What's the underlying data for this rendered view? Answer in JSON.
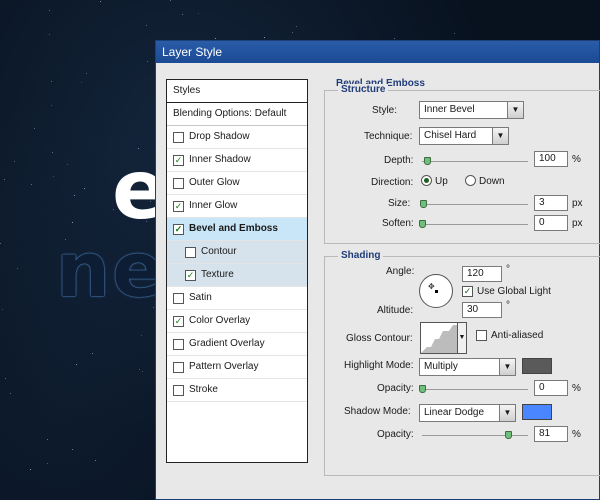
{
  "window": {
    "title": "Layer Style"
  },
  "styles_panel": {
    "header": "Styles",
    "blending_options": "Blending Options: Default",
    "items": [
      {
        "label": "Drop Shadow",
        "checked": false
      },
      {
        "label": "Inner Shadow",
        "checked": true
      },
      {
        "label": "Outer Glow",
        "checked": false
      },
      {
        "label": "Inner Glow",
        "checked": true
      },
      {
        "label": "Bevel and Emboss",
        "checked": true,
        "active": true
      },
      {
        "label": "Contour",
        "checked": false,
        "sub": true
      },
      {
        "label": "Texture",
        "checked": true,
        "sub": true
      },
      {
        "label": "Satin",
        "checked": false
      },
      {
        "label": "Color Overlay",
        "checked": true
      },
      {
        "label": "Gradient Overlay",
        "checked": false
      },
      {
        "label": "Pattern Overlay",
        "checked": false
      },
      {
        "label": "Stroke",
        "checked": false
      }
    ]
  },
  "bevel": {
    "section_title": "Bevel and Emboss",
    "structure": {
      "title": "Structure",
      "style_label": "Style:",
      "style_value": "Inner Bevel",
      "technique_label": "Technique:",
      "technique_value": "Chisel Hard",
      "depth_label": "Depth:",
      "depth_value": "100",
      "depth_unit": "%",
      "depth_level": 0.05,
      "direction_label": "Direction:",
      "direction_up": "Up",
      "direction_down": "Down",
      "direction_selected": "Up",
      "size_label": "Size:",
      "size_value": "3",
      "size_unit": "px",
      "size_level": 0.01,
      "soften_label": "Soften:",
      "soften_value": "0",
      "soften_unit": "px",
      "soften_level": 0.0
    },
    "shading": {
      "title": "Shading",
      "angle_label": "Angle:",
      "angle_value": "120",
      "angle_unit": "°",
      "global_light_label": "Use Global Light",
      "global_light_checked": true,
      "altitude_label": "Altitude:",
      "altitude_value": "30",
      "altitude_unit": "°",
      "gloss_label": "Gloss Contour:",
      "anti_aliased_label": "Anti-aliased",
      "anti_aliased_checked": false,
      "highlight_mode_label": "Highlight Mode:",
      "highlight_mode_value": "Multiply",
      "highlight_color": "#5a5a5a",
      "highlight_opacity_label": "Opacity:",
      "highlight_opacity_value": "0",
      "highlight_opacity_unit": "%",
      "highlight_opacity_level": 0.0,
      "shadow_mode_label": "Shadow Mode:",
      "shadow_mode_value": "Linear Dodge",
      "shadow_color": "#4a86ff",
      "shadow_opacity_label": "Opacity:",
      "shadow_opacity_value": "81",
      "shadow_opacity_unit": "%",
      "shadow_opacity_level": 0.81
    }
  },
  "background": {
    "letter_top": "e",
    "letters_bottom": "ne"
  }
}
